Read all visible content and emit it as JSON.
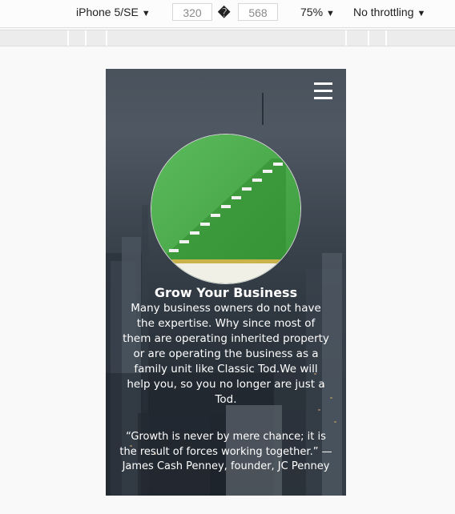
{
  "devtools": {
    "device": "iPhone 5/SE",
    "width": "320",
    "dimension_separator": "�",
    "height": "568",
    "zoom": "75%",
    "throttling": "No throttling",
    "dropdown_icon": "caret-down-icon"
  },
  "page": {
    "menu_icon": "hamburger-icon",
    "image_icon": "green-staircase-image",
    "title": "Grow Your Business",
    "description": "Many business owners do not have the expertise. Why since most of them are operating inherited property or are operating the business as a family unit like Classic Tod.We will help you, so you no longer are just a Tod.",
    "quote": "“Growth is never by mere chance; it is the result of forces working together.” — James Cash Penney, founder, JC Penney"
  }
}
